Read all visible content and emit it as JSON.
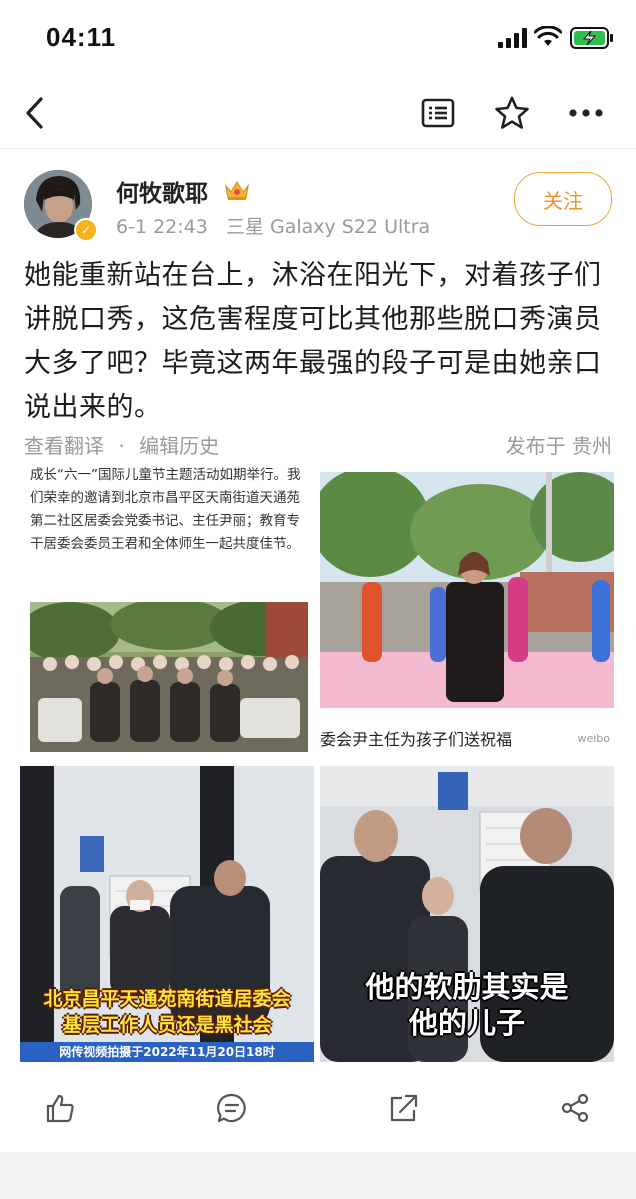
{
  "status_bar": {
    "time": "04:11"
  },
  "nav": {
    "back_icon": "chevron-left-icon",
    "reader_icon": "reader-mode-icon",
    "star_icon": "star-icon",
    "more_icon": "more-dots-icon"
  },
  "post": {
    "author": "何牧歌耶",
    "author_badge_icon": "crown-icon",
    "timestamp": "6-1 22:43",
    "device": "三星 Galaxy S22 Ultra",
    "follow_label": "关注",
    "text": "她能重新站在台上，沐浴在阳光下，对着孩子们讲脱口秀，这危害程度可比其他那些脱口秀演员大多了吧？毕竟这两年最强的段子可是由她亲口说出来的。",
    "view_translation": "查看翻译",
    "separator": "·",
    "edit_history": "编辑历史",
    "location": "发布于 贵州"
  },
  "images": {
    "img1_text": "成长“六一”国际儿童节主题活动如期举行。我们荣幸的邀请到北京市昌平区天南街道天通苑第二社区居委会党委书记、主任尹丽；教育专干居委会委员王君和全体师生一起共度佳节。",
    "img2_caption": "委会尹主任为孩子们送祝福",
    "img2_watermark": "weibo",
    "img3_overlay_1": "北京昌平天通苑南街道居委会",
    "img3_overlay_2": "基层工作人员还是黑社会",
    "img3_date": "网传视频拍摄于2022年11月20日18时",
    "img4_overlay_1": "他的软肋其实是",
    "img4_overlay_2": "他的儿子"
  },
  "actions": {
    "like_icon": "thumbs-up-icon",
    "comment_icon": "comment-icon",
    "repost_icon": "repost-icon",
    "share_icon": "share-icon"
  },
  "colors": {
    "accent": "#f0932a",
    "meta_gray": "#9a9a9a",
    "text": "#1c1c1c"
  }
}
